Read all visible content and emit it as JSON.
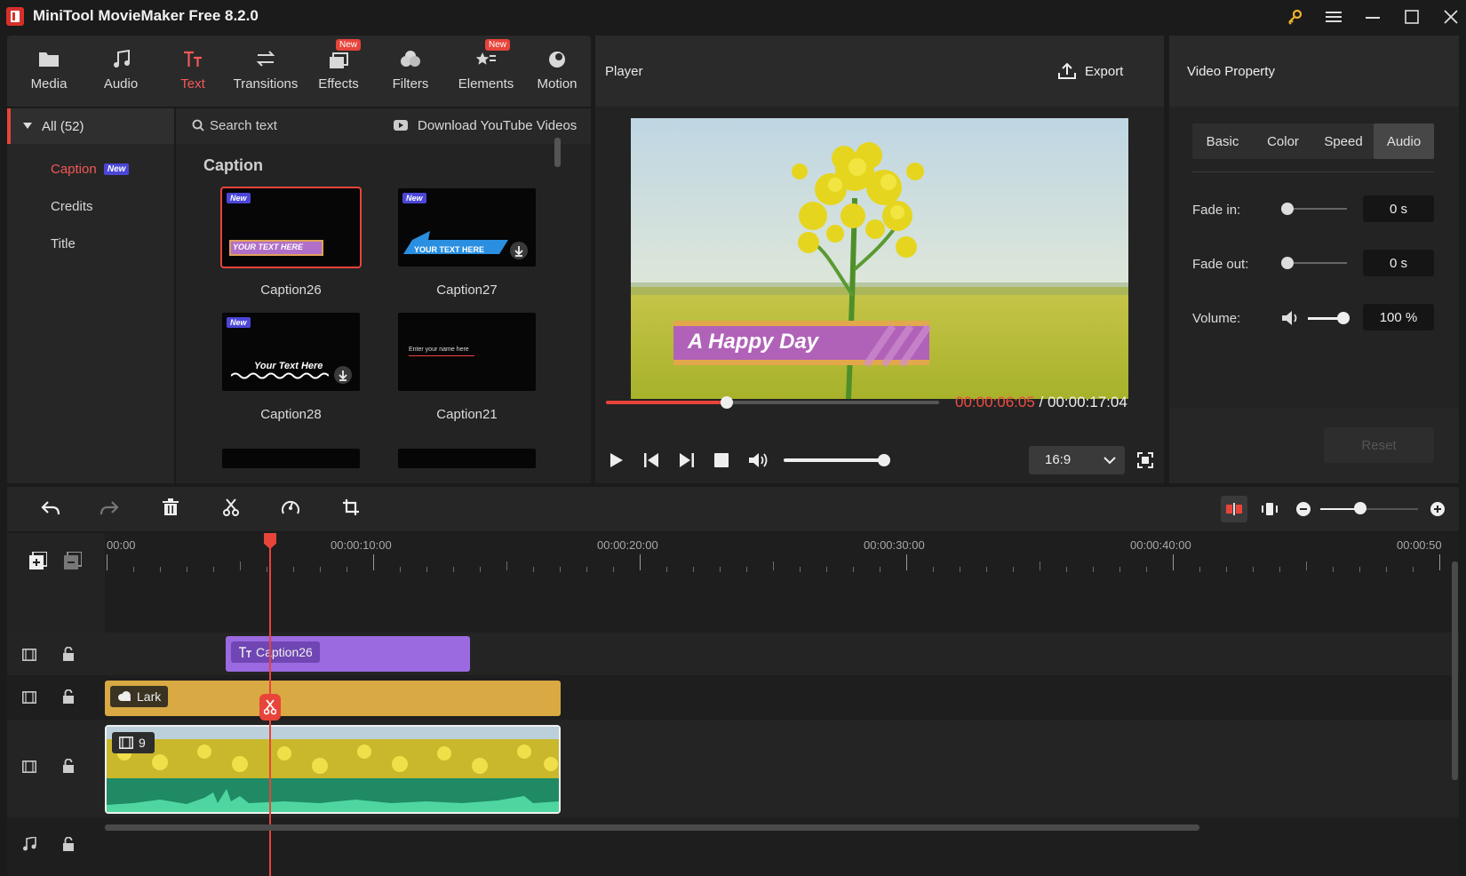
{
  "app": {
    "title": "MiniTool MovieMaker Free 8.2.0"
  },
  "toolbar": {
    "items": [
      {
        "label": "Media",
        "icon": "folder-icon"
      },
      {
        "label": "Audio",
        "icon": "music-note-icon"
      },
      {
        "label": "Text",
        "icon": "text-icon",
        "active": true
      },
      {
        "label": "Transitions",
        "icon": "transition-icon"
      },
      {
        "label": "Effects",
        "icon": "effects-icon",
        "badge": "New"
      },
      {
        "label": "Filters",
        "icon": "filters-icon"
      },
      {
        "label": "Elements",
        "icon": "elements-icon",
        "badge": "New"
      },
      {
        "label": "Motion",
        "icon": "motion-icon"
      }
    ]
  },
  "categories": {
    "all_label": "All (52)",
    "items": [
      {
        "label": "Caption",
        "badge": "New",
        "active": true
      },
      {
        "label": "Credits"
      },
      {
        "label": "Title"
      }
    ]
  },
  "library": {
    "search_placeholder": "Search text",
    "download_label": "Download YouTube Videos",
    "section_title": "Caption",
    "badge_new": "New",
    "items": [
      {
        "name": "Caption26",
        "preview_text": "YOUR TEXT HERE"
      },
      {
        "name": "Caption27",
        "preview_text": "YOUR TEXT HERE"
      },
      {
        "name": "Caption28",
        "preview_text": "Your Text Here"
      },
      {
        "name": "Caption21",
        "preview_text": "Enter your name here"
      }
    ]
  },
  "player": {
    "title": "Player",
    "export_label": "Export",
    "overlay_text": "A Happy Day",
    "current_time": "00:00:06:05",
    "separator": " / ",
    "total_time": "00:00:17:04",
    "aspect_ratio": "16:9",
    "progress": 0.37,
    "volume_level": 1.0
  },
  "property": {
    "title": "Video Property",
    "tabs": [
      "Basic",
      "Color",
      "Speed",
      "Audio"
    ],
    "active_tab": "Audio",
    "fade_in_label": "Fade in:",
    "fade_in_value": "0 s",
    "fade_out_label": "Fade out:",
    "fade_out_value": "0 s",
    "volume_label": "Volume:",
    "volume_value": "100 %",
    "reset_label": "Reset"
  },
  "timeline": {
    "time_labels": [
      "00:00",
      "00:00:10:00",
      "00:00:20:00",
      "00:00:30:00",
      "00:00:40:00",
      "00:00:50"
    ],
    "clips": {
      "caption": "Caption26",
      "audio": "Lark",
      "video_count": "9"
    },
    "colors": {
      "caption": "#8f5fe0",
      "audio": "#d9a943",
      "accent": "#e8443a"
    }
  }
}
